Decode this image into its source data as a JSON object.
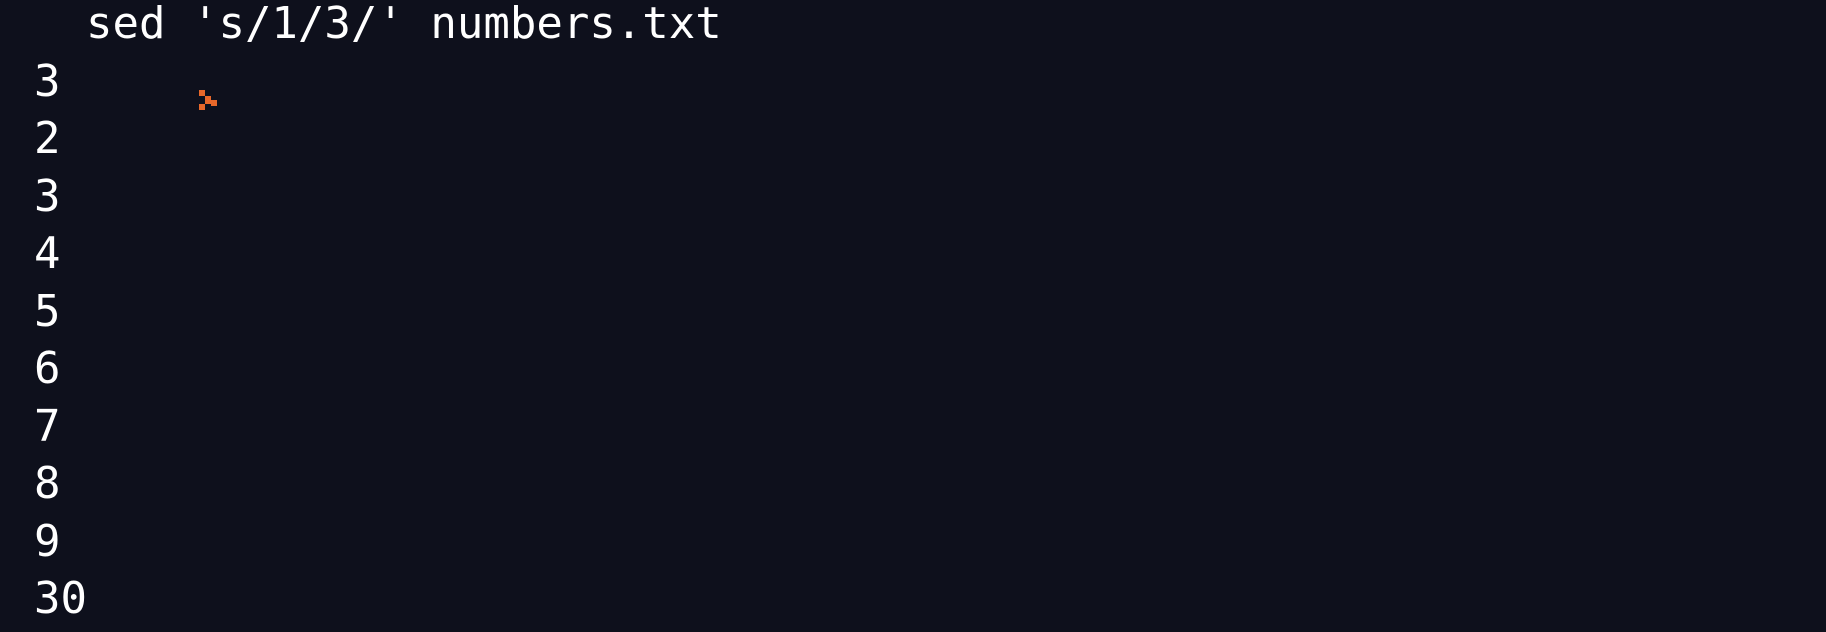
{
  "prompt": {
    "icon": "prompt-arrow-icon",
    "accent_color": "#e8682a",
    "command": "sed 's/1/3/' numbers.txt"
  },
  "output": [
    "3",
    "2",
    "3",
    "4",
    "5",
    "6",
    "7",
    "8",
    "9",
    "30"
  ],
  "colors": {
    "background": "#0e101c",
    "text": "#ffffff"
  }
}
